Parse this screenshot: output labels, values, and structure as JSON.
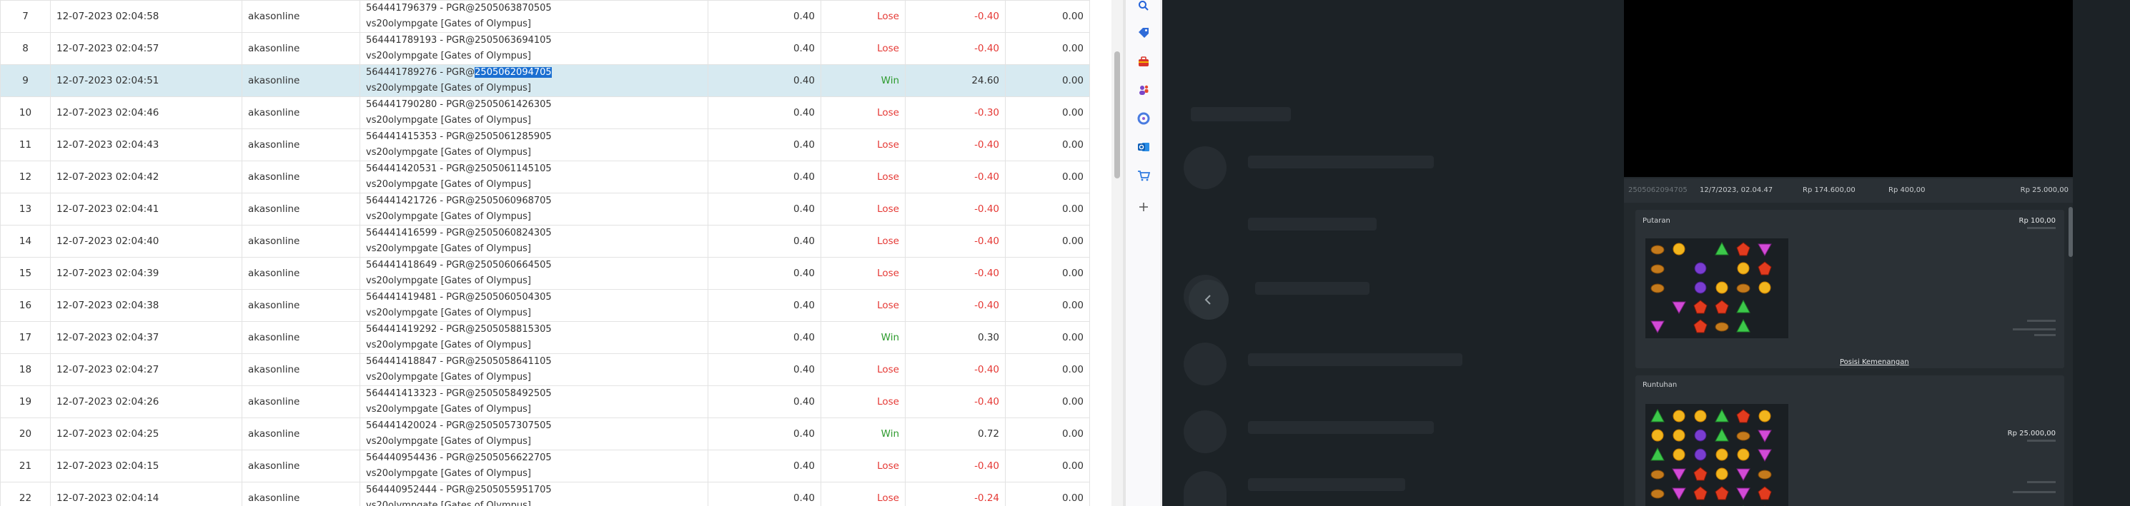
{
  "table": {
    "rows": [
      {
        "no": "7",
        "date": "12-07-2023 02:04:58",
        "user": "akasonline",
        "tx_line1": "564441796379 - PGR@2505063870505",
        "tx_line2": "vs20olympgate [Gates of Olympus]",
        "bet": "0.40",
        "status": "Lose",
        "win": "-0.40",
        "jp": "0.00"
      },
      {
        "no": "8",
        "date": "12-07-2023 02:04:57",
        "user": "akasonline",
        "tx_line1": "564441789193 - PGR@2505063694105",
        "tx_line2": "vs20olympgate [Gates of Olympus]",
        "bet": "0.40",
        "status": "Lose",
        "win": "-0.40",
        "jp": "0.00"
      },
      {
        "no": "9",
        "date": "12-07-2023 02:04:51",
        "user": "akasonline",
        "tx_prefix": "564441789276 - PGR@",
        "tx_highlight": "2505062094705",
        "tx_line2": "vs20olympgate [Gates of Olympus]",
        "bet": "0.40",
        "status": "Win",
        "win": "24.60",
        "jp": "0.00",
        "selected": true
      },
      {
        "no": "10",
        "date": "12-07-2023 02:04:46",
        "user": "akasonline",
        "tx_line1": "564441790280 - PGR@2505061426305",
        "tx_line2": "vs20olympgate [Gates of Olympus]",
        "bet": "0.40",
        "status": "Lose",
        "win": "-0.30",
        "jp": "0.00"
      },
      {
        "no": "11",
        "date": "12-07-2023 02:04:43",
        "user": "akasonline",
        "tx_line1": "564441415353 - PGR@2505061285905",
        "tx_line2": "vs20olympgate [Gates of Olympus]",
        "bet": "0.40",
        "status": "Lose",
        "win": "-0.40",
        "jp": "0.00"
      },
      {
        "no": "12",
        "date": "12-07-2023 02:04:42",
        "user": "akasonline",
        "tx_line1": "564441420531 - PGR@2505061145105",
        "tx_line2": "vs20olympgate [Gates of Olympus]",
        "bet": "0.40",
        "status": "Lose",
        "win": "-0.40",
        "jp": "0.00"
      },
      {
        "no": "13",
        "date": "12-07-2023 02:04:41",
        "user": "akasonline",
        "tx_line1": "564441421726 - PGR@2505060968705",
        "tx_line2": "vs20olympgate [Gates of Olympus]",
        "bet": "0.40",
        "status": "Lose",
        "win": "-0.40",
        "jp": "0.00"
      },
      {
        "no": "14",
        "date": "12-07-2023 02:04:40",
        "user": "akasonline",
        "tx_line1": "564441416599 - PGR@2505060824305",
        "tx_line2": "vs20olympgate [Gates of Olympus]",
        "bet": "0.40",
        "status": "Lose",
        "win": "-0.40",
        "jp": "0.00"
      },
      {
        "no": "15",
        "date": "12-07-2023 02:04:39",
        "user": "akasonline",
        "tx_line1": "564441418649 - PGR@2505060664505",
        "tx_line2": "vs20olympgate [Gates of Olympus]",
        "bet": "0.40",
        "status": "Lose",
        "win": "-0.40",
        "jp": "0.00"
      },
      {
        "no": "16",
        "date": "12-07-2023 02:04:38",
        "user": "akasonline",
        "tx_line1": "564441419481 - PGR@2505060504305",
        "tx_line2": "vs20olympgate [Gates of Olympus]",
        "bet": "0.40",
        "status": "Lose",
        "win": "-0.40",
        "jp": "0.00"
      },
      {
        "no": "17",
        "date": "12-07-2023 02:04:37",
        "user": "akasonline",
        "tx_line1": "564441419292 - PGR@2505058815305",
        "tx_line2": "vs20olympgate [Gates of Olympus]",
        "bet": "0.40",
        "status": "Win",
        "win": "0.30",
        "jp": "0.00"
      },
      {
        "no": "18",
        "date": "12-07-2023 02:04:27",
        "user": "akasonline",
        "tx_line1": "564441418847 - PGR@2505058641105",
        "tx_line2": "vs20olympgate [Gates of Olympus]",
        "bet": "0.40",
        "status": "Lose",
        "win": "-0.40",
        "jp": "0.00"
      },
      {
        "no": "19",
        "date": "12-07-2023 02:04:26",
        "user": "akasonline",
        "tx_line1": "564441413323 - PGR@2505058492505",
        "tx_line2": "vs20olympgate [Gates of Olympus]",
        "bet": "0.40",
        "status": "Lose",
        "win": "-0.40",
        "jp": "0.00"
      },
      {
        "no": "20",
        "date": "12-07-2023 02:04:25",
        "user": "akasonline",
        "tx_line1": "564441420024 - PGR@2505057307505",
        "tx_line2": "vs20olympgate [Gates of Olympus]",
        "bet": "0.40",
        "status": "Win",
        "win": "0.72",
        "jp": "0.00"
      },
      {
        "no": "21",
        "date": "12-07-2023 02:04:15",
        "user": "akasonline",
        "tx_line1": "564440954436 - PGR@2505056622705",
        "tx_line2": "vs20olympgate [Gates of Olympus]",
        "bet": "0.40",
        "status": "Lose",
        "win": "-0.40",
        "jp": "0.00"
      },
      {
        "no": "22",
        "date": "12-07-2023 02:04:14",
        "user": "akasonline",
        "tx_line1": "564440952444 - PGR@2505055951705",
        "tx_line2": "vs20olympgate [Gates of Olympus]",
        "bet": "0.40",
        "status": "Lose",
        "win": "-0.24",
        "jp": "0.00"
      }
    ]
  },
  "browser_sidebar": {
    "icons": [
      "search-icon",
      "tag-icon",
      "toolbox-icon",
      "people-icon",
      "copilot-icon",
      "outlook-icon",
      "shopping-cart-icon",
      "add-icon"
    ]
  },
  "game_detail": {
    "summary": {
      "round_id": "2505062094705",
      "datetime": "12/7/2023, 02.04.47",
      "balance": "Rp 174.600,00",
      "bet": "Rp 400,00",
      "win": "Rp 25.000,00"
    },
    "spin_title": "Putaran",
    "spin_amount": "Rp 100,00",
    "winning_positions_link": "Posisi Kemenangan",
    "cascade_title": "Runtuhan",
    "cascade_amount": "Rp 25.000,00"
  },
  "colors": {
    "lose": "#e53935",
    "win": "#2e9b2e",
    "selection": "#1b6fd1",
    "panel_bg": "#1c2226"
  }
}
